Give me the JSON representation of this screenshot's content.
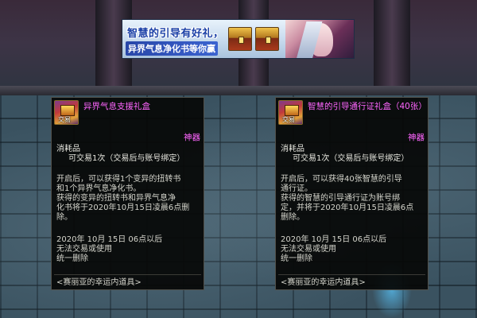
{
  "banner": {
    "line1": "智慧的引导有好礼，",
    "line2": "异界气息净化书等你赢"
  },
  "panels": [
    {
      "item_name": "异界气息支援礼盒",
      "trade_tag": "交易",
      "rarity": "神器",
      "type": "消耗品",
      "trade_rule": "可交易1次（交易后与账号绑定）",
      "description": [
        "开启后，可以获得1个变异的扭转书",
        "和1个异界气息净化书。",
        "获得的变异的扭转书和异界气息净",
        "化书将于2020年10月15日凌晨6点删",
        "除。"
      ],
      "expiry": [
        "2020年 10月 15日 06点以后",
        "无法交易或使用",
        "统一删除"
      ],
      "source": "<赛丽亚的幸运内道具>"
    },
    {
      "item_name": "智慧的引导通行证礼盒（40张）",
      "trade_tag": "交易",
      "rarity": "神器",
      "type": "消耗品",
      "trade_rule": "可交易1次（交易后与账号绑定）",
      "description": [
        "开启后，可以获得40张智慧的引导",
        "通行证。",
        "获得的智慧的引导通行证为账号绑",
        "定，并将于2020年10月15日凌晨6点",
        "删除。"
      ],
      "expiry": [
        "2020年 10月 15日 06点以后",
        "无法交易或使用",
        "统一删除"
      ],
      "source": "<赛丽亚的幸运内道具>"
    }
  ],
  "colors": {
    "item_name": "#ff66ff",
    "rarity": "#ff66ff",
    "panel_bg": "#060806",
    "banner_blue": "#1a3fa6"
  },
  "icons": [
    "treasure-chest-icon",
    "gift-box-icon"
  ]
}
